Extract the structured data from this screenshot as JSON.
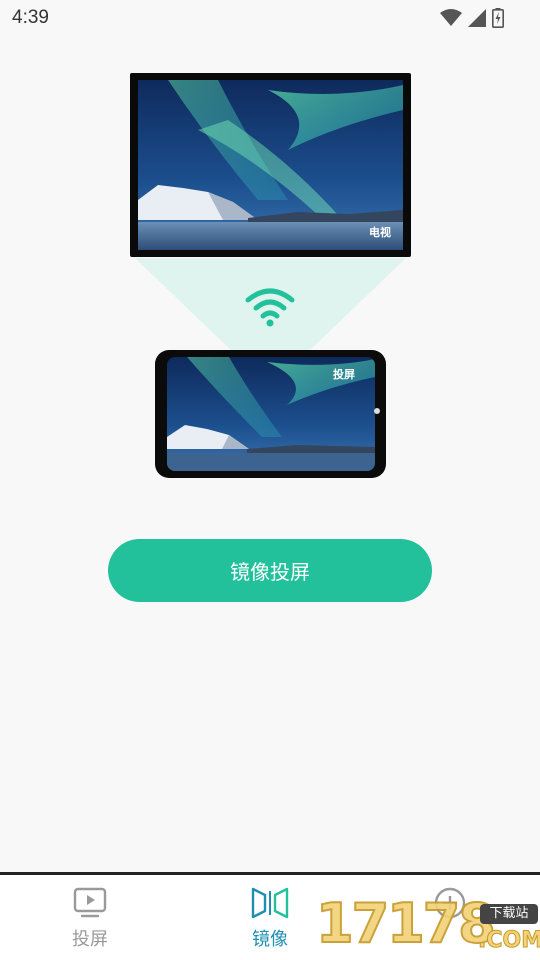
{
  "status_bar": {
    "time": "4:39"
  },
  "illustration": {
    "tv_label": "电视",
    "phone_label": "投屏",
    "accent_color": "#22c19b",
    "cone_color": "#dff4ee"
  },
  "actions": {
    "mirror_button_label": "镜像投屏"
  },
  "tabs": [
    {
      "label": "投屏",
      "icon": "tv-play-icon",
      "active": false
    },
    {
      "label": "镜像",
      "icon": "mirror-icon",
      "active": true
    }
  ],
  "watermark": {
    "number": "17178",
    "badge": "下载站",
    "suffix": ".COM"
  }
}
